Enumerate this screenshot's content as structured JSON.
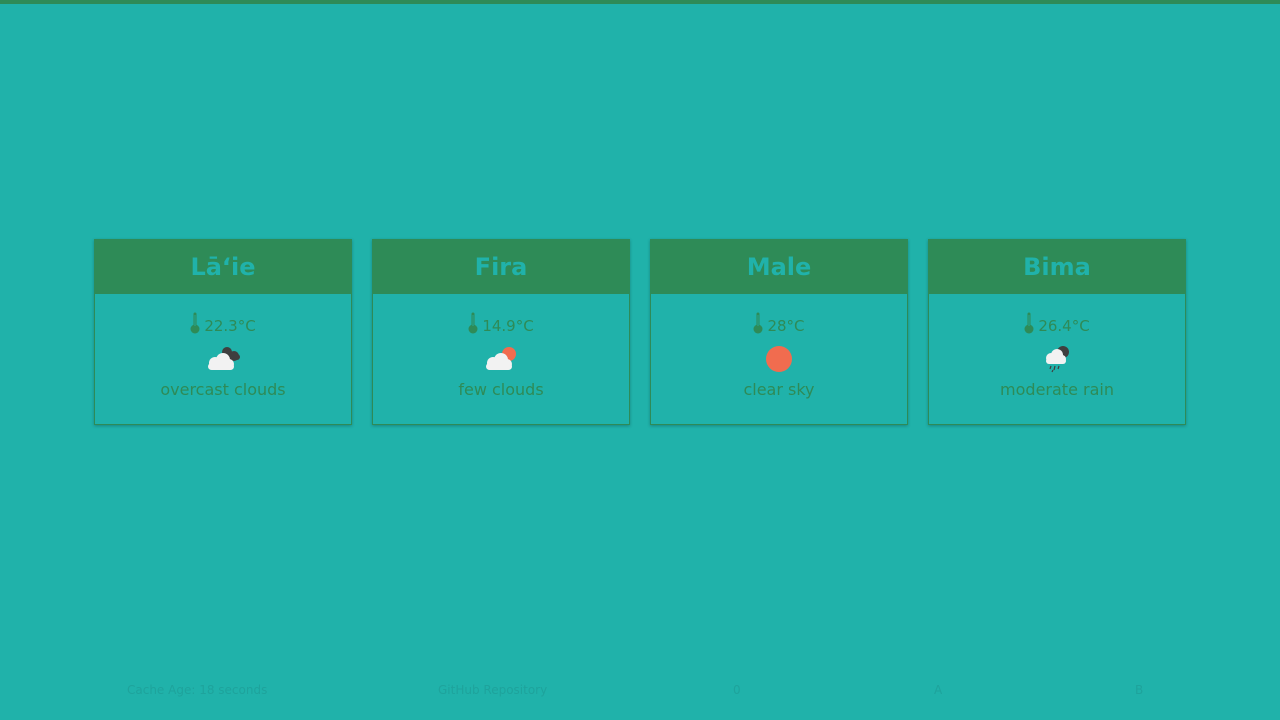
{
  "colors": {
    "background": "#20b2aa",
    "accent": "#2e8b57",
    "sun": "#f16c4f",
    "cloud": "#f2f2f2",
    "dark_cloud": "#3f3f3f"
  },
  "cards": [
    {
      "city": "Lāʻie",
      "temp": "22.3°C",
      "icon": "overcast-clouds-icon",
      "description": "overcast clouds"
    },
    {
      "city": "Fira",
      "temp": "14.9°C",
      "icon": "few-clouds-icon",
      "description": "few clouds"
    },
    {
      "city": "Male",
      "temp": "28°C",
      "icon": "clear-sky-icon",
      "description": "clear sky"
    },
    {
      "city": "Bima",
      "temp": "26.4°C",
      "icon": "moderate-rain-icon",
      "description": "moderate rain"
    }
  ],
  "footer": {
    "cache_age": "Cache Age: 18 seconds",
    "repo_link": "GitHub Repository",
    "key_0": "0",
    "key_a": "A",
    "key_b": "B"
  }
}
